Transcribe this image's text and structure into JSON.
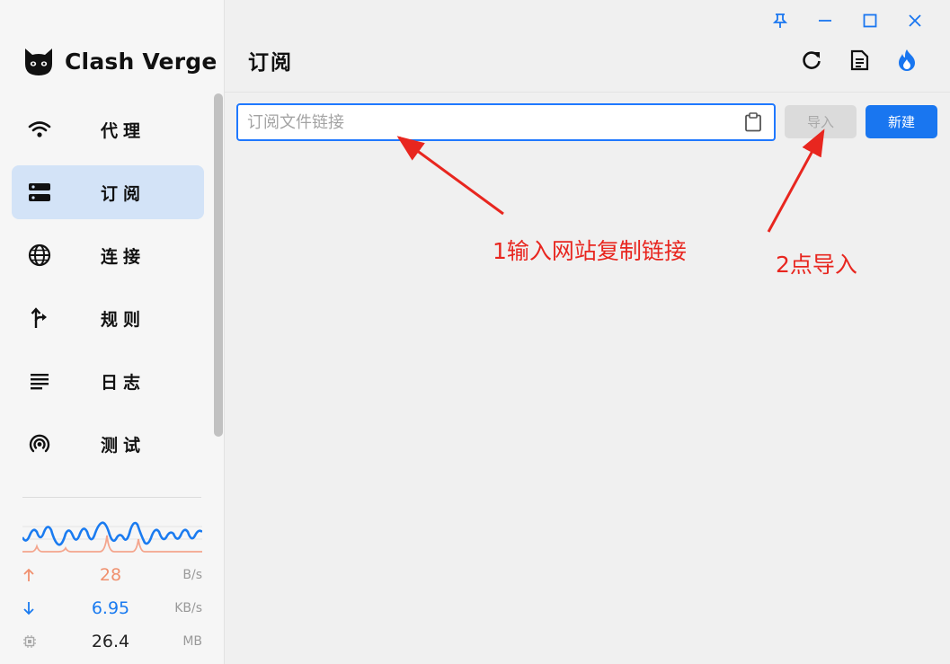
{
  "app": {
    "name": "Clash Verge"
  },
  "sidebar": {
    "items": [
      {
        "label": "代理",
        "icon": "wifi-icon",
        "active": false
      },
      {
        "label": "订阅",
        "icon": "server-icon",
        "active": true
      },
      {
        "label": "连接",
        "icon": "globe-icon",
        "active": false
      },
      {
        "label": "规则",
        "icon": "fork-arrow-icon",
        "active": false
      },
      {
        "label": "日志",
        "icon": "log-lines-icon",
        "active": false
      },
      {
        "label": "测试",
        "icon": "radar-icon",
        "active": false
      }
    ]
  },
  "traffic": {
    "upload": {
      "value": "28",
      "unit": "B/s",
      "icon": "arrow-up-icon"
    },
    "download": {
      "value": "6.95",
      "unit": "KB/s",
      "icon": "arrow-down-icon"
    },
    "memory": {
      "value": "26.4",
      "unit": "MB",
      "icon": "chip-icon"
    }
  },
  "colors": {
    "accent": "#1976f0",
    "upload": "#f0906e",
    "download": "#1a7bf0",
    "active_nav_bg": "#d3e3f7",
    "annotation": "#e8261f"
  },
  "page": {
    "title": "订阅",
    "actions": [
      "refresh-icon",
      "document-icon",
      "flame-icon"
    ]
  },
  "import_bar": {
    "url_value": "",
    "url_placeholder": "订阅文件链接",
    "paste_icon": "clipboard-icon",
    "import_label": "导入",
    "import_disabled": true,
    "new_label": "新建"
  },
  "window_controls": [
    "pin-icon",
    "minimize-icon",
    "maximize-icon",
    "close-icon"
  ],
  "annotations": {
    "step1": "1输入网站复制链接",
    "step2": "2点导入"
  }
}
